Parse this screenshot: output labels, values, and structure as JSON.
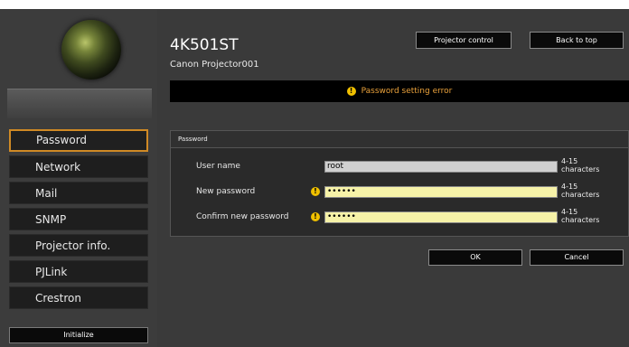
{
  "product": {
    "title": "4K501ST",
    "name": "Canon Projector001"
  },
  "top_buttons": {
    "projector_control": "Projector control",
    "back_to_top": "Back to top"
  },
  "error": {
    "message": "Password setting error"
  },
  "sidebar": {
    "items": [
      {
        "label": "Password",
        "active": true
      },
      {
        "label": "Network"
      },
      {
        "label": "Mail"
      },
      {
        "label": "SNMP"
      },
      {
        "label": "Projector info."
      },
      {
        "label": "PJLink"
      },
      {
        "label": "Crestron"
      }
    ],
    "initialize_label": "Initialize"
  },
  "panel": {
    "header": "Password",
    "rows": [
      {
        "label": "User name",
        "value": "root",
        "note_line1": "4-15",
        "note_line2": "characters"
      },
      {
        "label": "New password",
        "value": "••••••",
        "note_line1": "4-15",
        "note_line2": "characters"
      },
      {
        "label": "Confirm new password",
        "value": "••••••",
        "note_line1": "4-15",
        "note_line2": "characters"
      }
    ]
  },
  "actions": {
    "ok": "OK",
    "cancel": "Cancel"
  },
  "colors": {
    "accent": "#d08a25",
    "error_text": "#e9a13b",
    "warning_icon": "#f0c000"
  }
}
